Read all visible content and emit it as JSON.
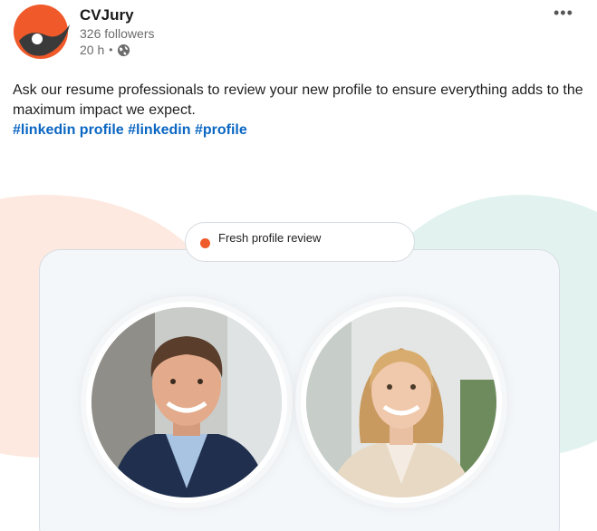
{
  "author": {
    "name": "CVJury",
    "followers": "326 followers",
    "time": "20 h",
    "visibility_icon": "globe-icon",
    "logo_colors": [
      "#f0592a",
      "#3a3a3a"
    ]
  },
  "menu": {
    "more_label": "•••"
  },
  "post": {
    "text": "Ask our resume professionals to review your new profile to ensure everything adds to the maximum impact we expect.",
    "hashtags": [
      "#linkedin profile",
      "#linkedin",
      "#profile"
    ]
  },
  "image": {
    "badge_label": "Fresh profile review",
    "badge_dot_color": "#ef5a2a",
    "left_portrait": "man-portrait",
    "right_portrait": "woman-portrait"
  }
}
